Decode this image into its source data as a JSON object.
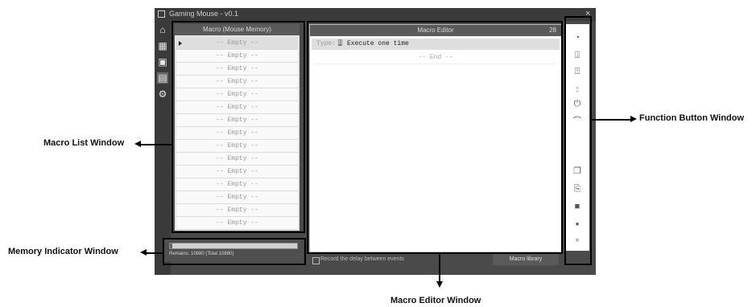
{
  "app": {
    "title": "Gaming Mouse - v0.1",
    "close_glyph": "×"
  },
  "sidebar": {
    "items": [
      {
        "icon": "home-icon",
        "glyph": "⌂"
      },
      {
        "icon": "grid-icon",
        "glyph": "▦"
      },
      {
        "icon": "window-icon",
        "glyph": "▣"
      },
      {
        "icon": "macro-icon",
        "glyph": "▤"
      },
      {
        "icon": "gear-icon",
        "glyph": "⚙"
      }
    ]
  },
  "macro_list": {
    "header": "Macro (Mouse Memory)",
    "slots": [
      "-- Empty --",
      "-- Empty --",
      "-- Empty --",
      "-- Empty --",
      "-- Empty --",
      "-- Empty --",
      "-- Empty --",
      "-- Empty --",
      "-- Empty --",
      "-- Empty --",
      "-- Empty --",
      "-- Empty --",
      "-- Empty --",
      "-- Empty --",
      "-- Empty --"
    ]
  },
  "memory": {
    "text": "Remains: 10880 (Total 10880)",
    "used_fraction": 0.02
  },
  "editor": {
    "header": "Macro Editor",
    "count": "28",
    "type_label": "Type:",
    "type_value": "Execute one time",
    "end_text": "-- End --"
  },
  "footer": {
    "checkbox_text": "Record the delay between events",
    "library_button": "Macro library"
  },
  "function_buttons": [
    {
      "icon": "timer-icon",
      "glyph": "◔"
    },
    {
      "icon": "key-down-icon",
      "glyph": "⍗"
    },
    {
      "icon": "key-up-icon",
      "glyph": "⍐"
    },
    {
      "icon": "mouse-down-icon",
      "glyph": "⍛"
    },
    {
      "icon": "mouse-up-icon",
      "glyph": "⏻"
    },
    {
      "icon": "wheel-icon",
      "glyph": "⌒"
    },
    {
      "icon": "copy-icon",
      "glyph": "❐"
    },
    {
      "icon": "paste-icon",
      "glyph": "⎘"
    },
    {
      "icon": "save-icon",
      "glyph": "■"
    },
    {
      "icon": "record-icon",
      "glyph": "●"
    },
    {
      "icon": "stop-icon",
      "glyph": "■"
    }
  ],
  "callouts": {
    "macro_list": "Macro List Window",
    "memory": "Memory Indicator Window",
    "editor": "Macro Editor Window",
    "function": "Function Button Window"
  },
  "colors": {
    "window_bg": "#4a4a4a",
    "panel_bg": "#e6e6e6",
    "callout": "#000000"
  }
}
